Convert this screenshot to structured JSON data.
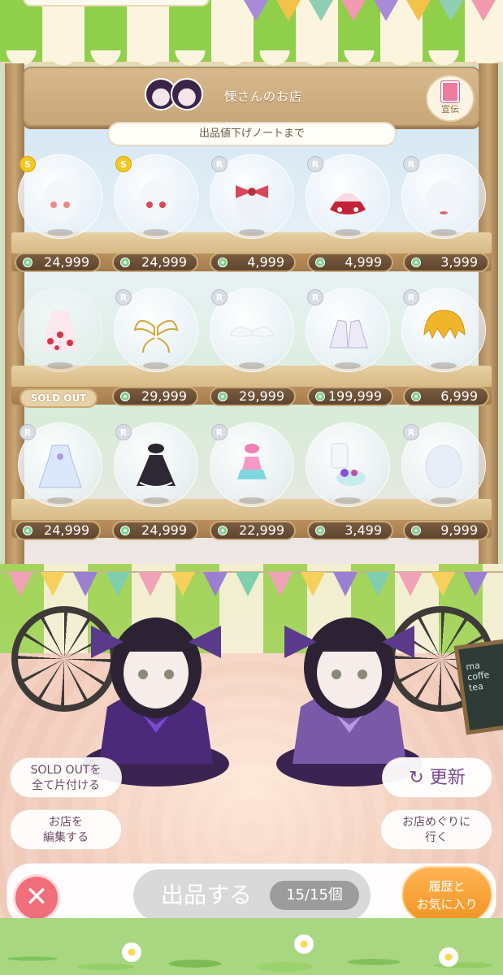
{
  "shop": {
    "name": "慄さんのお店",
    "ad_label": "宣伝",
    "note_banner": "出品値下げノートまで"
  },
  "shelves": [
    {
      "items": [
        {
          "rarity": "S",
          "price": "24,999",
          "art": "eyes-icon"
        },
        {
          "rarity": "S",
          "price": "24,999",
          "art": "eyes-icon"
        },
        {
          "rarity": "R",
          "price": "4,999",
          "art": "hair-bow-icon"
        },
        {
          "rarity": "R",
          "price": "4,999",
          "art": "strawberry-skirt-icon"
        },
        {
          "rarity": "R",
          "price": "3,999",
          "art": "lips-icon"
        }
      ]
    },
    {
      "items": [
        {
          "rarity": "",
          "price": "",
          "sold_out": "SOLD OUT",
          "art": "strawberry-dress-icon"
        },
        {
          "rarity": "R",
          "price": "29,999",
          "art": "gold-wings-icon"
        },
        {
          "rarity": "R",
          "price": "29,999",
          "art": "white-wings-icon"
        },
        {
          "rarity": "R",
          "price": "199,999",
          "art": "lace-shoes-icon"
        },
        {
          "rarity": "R",
          "price": "6,999",
          "art": "blonde-wig-icon"
        }
      ]
    },
    {
      "items": [
        {
          "rarity": "R",
          "price": "24,999",
          "art": "blue-dress-icon"
        },
        {
          "rarity": "R",
          "price": "24,999",
          "art": "black-dress-icon"
        },
        {
          "rarity": "R",
          "price": "22,999",
          "art": "pink-swimsuit-icon"
        },
        {
          "rarity": "",
          "price": "3,499",
          "art": "teacup-icon"
        },
        {
          "rarity": "R",
          "price": "9,999",
          "art": "face-icon"
        }
      ]
    }
  ],
  "actions": {
    "clear_soldout": "SOLD OUTを\n全て片付ける",
    "edit_shop": "お店を\n編集する",
    "refresh": "更新",
    "visit_shops": "お店めぐりに\n行く",
    "list_item": "出品する",
    "count": "15/15個",
    "history": "履歴と\nお気に入り"
  },
  "chalkboard_text": "ma\ncoffe\ntea",
  "colors": {
    "awning_green": "#8fcf4a",
    "price_tag": "#6b4f36",
    "close": "#f06f7a",
    "history": "#f39424",
    "refresh_text": "#7a4a8e"
  }
}
